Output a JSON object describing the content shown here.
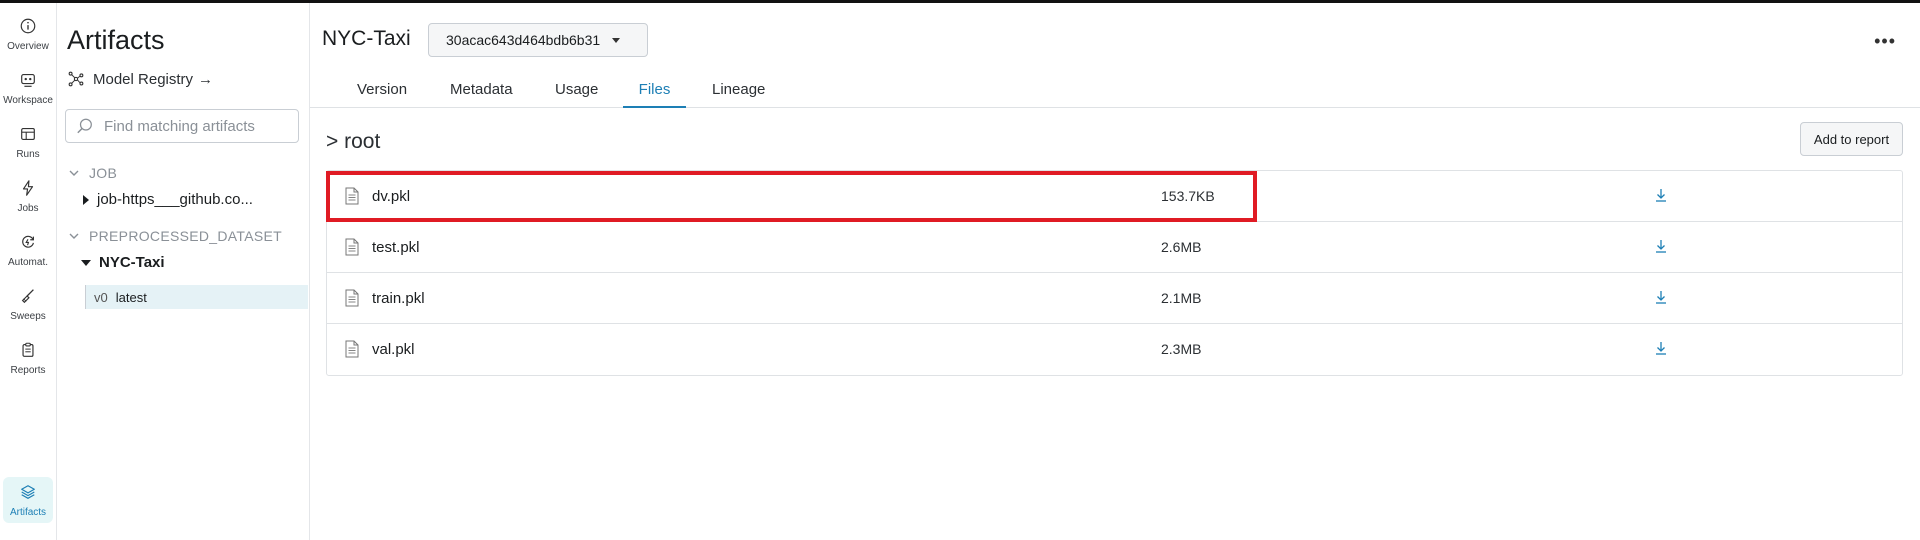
{
  "rail": {
    "items": [
      {
        "label": "Overview",
        "icon": "info-icon"
      },
      {
        "label": "Workspace",
        "icon": "workspace-icon"
      },
      {
        "label": "Runs",
        "icon": "table-icon"
      },
      {
        "label": "Jobs",
        "icon": "lightning-icon"
      },
      {
        "label": "Automat.",
        "icon": "automation-icon"
      },
      {
        "label": "Sweeps",
        "icon": "broom-icon"
      },
      {
        "label": "Reports",
        "icon": "clipboard-icon"
      },
      {
        "label": "Artifacts",
        "icon": "layers-icon",
        "active": true
      }
    ]
  },
  "sidebar": {
    "title": "Artifacts",
    "registry_label": "Model Registry",
    "registry_arrow": "→",
    "search_placeholder": "Find matching artifacts",
    "groups": [
      {
        "label": "JOB",
        "items": [
          {
            "label": "job-https___github.co..."
          }
        ]
      },
      {
        "label": "PREPROCESSED_DATASET",
        "items": [
          {
            "label": "NYC-Taxi",
            "version": "v0",
            "alias": "latest"
          }
        ]
      }
    ]
  },
  "main": {
    "artifact_title": "NYC-Taxi",
    "version_hash": "30acac643d464bdb6b31",
    "more": "•••",
    "tabs": [
      "Version",
      "Metadata",
      "Usage",
      "Files",
      "Lineage"
    ],
    "active_tab": "Files",
    "breadcrumb": "> root",
    "add_button": "Add to report",
    "files": [
      {
        "name": "dv.pkl",
        "size": "153.7KB"
      },
      {
        "name": "test.pkl",
        "size": "2.6MB"
      },
      {
        "name": "train.pkl",
        "size": "2.1MB"
      },
      {
        "name": "val.pkl",
        "size": "2.3MB"
      }
    ]
  },
  "colors": {
    "accent": "#1d7fb5",
    "highlight": "#e01b24",
    "active_bg": "#e5f6f7"
  }
}
